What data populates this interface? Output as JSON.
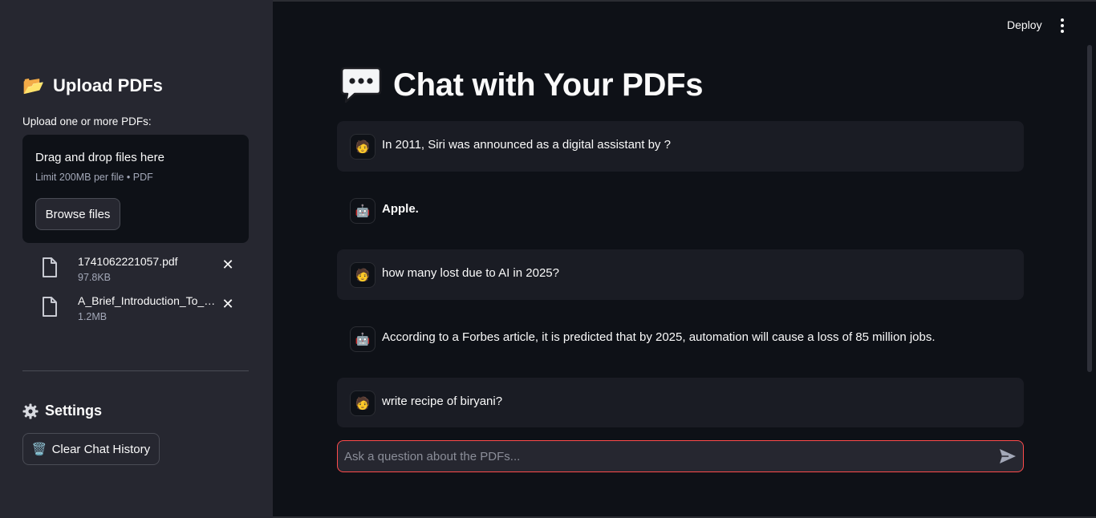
{
  "topbar": {
    "deploy_label": "Deploy",
    "menu_icon": "vertical-dots-icon"
  },
  "sidebar": {
    "header_emoji": "📂",
    "header": "Upload PDFs",
    "upload_label": "Upload one or more PDFs:",
    "dropzone": {
      "title": "Drag and drop files here",
      "limit": "Limit 200MB per file • PDF",
      "browse_label": "Browse files"
    },
    "files": [
      {
        "name": "1741062221057.pdf",
        "size": "97.8KB"
      },
      {
        "name": "A_Brief_Introduction_To_AI.pdf",
        "size": "1.2MB"
      }
    ],
    "settings_header": "Settings",
    "clear_label": "Clear Chat History",
    "clear_emoji": "🗑️"
  },
  "main": {
    "title": "Chat with Your PDFs",
    "title_icon": "speech-bubble-icon",
    "messages": [
      {
        "role": "user",
        "avatar": "🧑",
        "text": "In 2011, Siri was announced as a digital assistant by ?"
      },
      {
        "role": "assistant",
        "avatar": "🤖",
        "text": "Apple."
      },
      {
        "role": "user",
        "avatar": "🧑",
        "text": "how many lost due to AI in 2025?"
      },
      {
        "role": "assistant",
        "avatar": "🤖",
        "text": "According to a Forbes article, it is predicted that by 2025, automation will cause a loss of 85 million jobs."
      },
      {
        "role": "user",
        "avatar": "🧑",
        "text": "write recipe of biryani?"
      }
    ],
    "chat_input": {
      "placeholder": "Ask a question about the PDFs...",
      "value": ""
    }
  },
  "colors": {
    "background": "#0e1117",
    "sidebar": "#262730",
    "accent": "#ff4b4b",
    "user_message_bg": "#1a1c24"
  }
}
